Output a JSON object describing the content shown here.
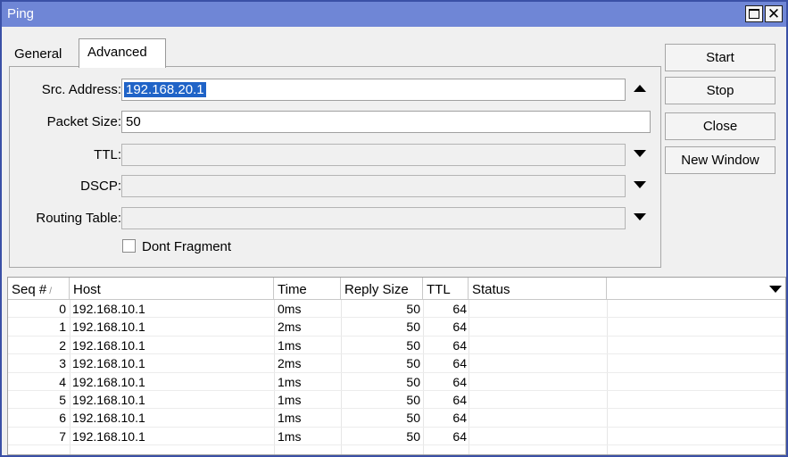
{
  "window": {
    "title": "Ping"
  },
  "tabs": [
    {
      "label": "General"
    },
    {
      "label": "Advanced"
    }
  ],
  "form": {
    "src_address_label": "Src. Address:",
    "src_address_value": "192.168.20.1",
    "packet_size_label": "Packet Size:",
    "packet_size_value": "50",
    "ttl_label": "TTL:",
    "ttl_value": "",
    "dscp_label": "DSCP:",
    "dscp_value": "",
    "routing_table_label": "Routing Table:",
    "routing_table_value": "",
    "dont_fragment_label": "Dont Fragment",
    "dont_fragment_checked": false
  },
  "buttons": {
    "start": "Start",
    "stop": "Stop",
    "close": "Close",
    "new_window": "New Window"
  },
  "table": {
    "columns": [
      "Seq #",
      "Host",
      "Time",
      "Reply Size",
      "TTL",
      "Status"
    ],
    "sort_indicator": "/",
    "rows": [
      {
        "seq": "0",
        "host": "192.168.10.1",
        "time": "0ms",
        "reply_size": "50",
        "ttl": "64",
        "status": ""
      },
      {
        "seq": "1",
        "host": "192.168.10.1",
        "time": "2ms",
        "reply_size": "50",
        "ttl": "64",
        "status": ""
      },
      {
        "seq": "2",
        "host": "192.168.10.1",
        "time": "1ms",
        "reply_size": "50",
        "ttl": "64",
        "status": ""
      },
      {
        "seq": "3",
        "host": "192.168.10.1",
        "time": "2ms",
        "reply_size": "50",
        "ttl": "64",
        "status": ""
      },
      {
        "seq": "4",
        "host": "192.168.10.1",
        "time": "1ms",
        "reply_size": "50",
        "ttl": "64",
        "status": ""
      },
      {
        "seq": "5",
        "host": "192.168.10.1",
        "time": "1ms",
        "reply_size": "50",
        "ttl": "64",
        "status": ""
      },
      {
        "seq": "6",
        "host": "192.168.10.1",
        "time": "1ms",
        "reply_size": "50",
        "ttl": "64",
        "status": ""
      },
      {
        "seq": "7",
        "host": "192.168.10.1",
        "time": "1ms",
        "reply_size": "50",
        "ttl": "64",
        "status": ""
      }
    ]
  },
  "colors": {
    "titlebar": "#6f86d6",
    "selection": "#1f63c7"
  },
  "icons": {
    "restore": "restore-icon",
    "close": "close-icon",
    "dropdown": "triangle-down-icon",
    "collapse": "triangle-up-icon"
  }
}
